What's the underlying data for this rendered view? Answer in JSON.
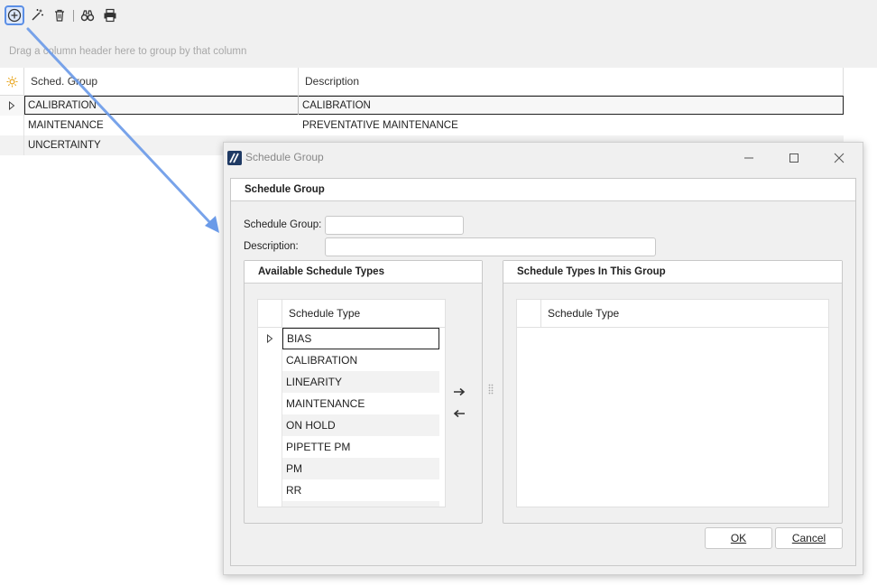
{
  "toolbar": {
    "icons": [
      "add-icon",
      "magic-wand-icon",
      "trash-icon",
      "binoculars-icon",
      "print-icon"
    ]
  },
  "group_panel": {
    "hint": "Drag a column header here to group by that column"
  },
  "grid": {
    "columns": [
      "Sched. Group",
      "Description"
    ],
    "rows": [
      {
        "group": "CALIBRATION",
        "description": "CALIBRATION"
      },
      {
        "group": "MAINTENANCE",
        "description": "PREVENTATIVE MAINTENANCE"
      },
      {
        "group": "UNCERTAINTY",
        "description": ""
      }
    ]
  },
  "dialog": {
    "title": "Schedule Group",
    "section_title": "Schedule Group",
    "schedule_group_label": "Schedule Group:",
    "schedule_group_value": "",
    "description_label": "Description:",
    "description_value": "",
    "available": {
      "title": "Available Schedule Types",
      "column": "Schedule Type",
      "items": [
        "BIAS",
        "CALIBRATION",
        "LINEARITY",
        "MAINTENANCE",
        "ON HOLD",
        "PIPETTE PM",
        "PM",
        "RR"
      ]
    },
    "in_group": {
      "title": "Schedule Types In This Group",
      "column": "Schedule Type",
      "items": []
    },
    "ok_label": "OK",
    "cancel_label": "Cancel"
  },
  "colors": {
    "highlight": "#5b8fe6",
    "callout_arrow": "#6a9ae8",
    "logo": "#1f3a64"
  }
}
